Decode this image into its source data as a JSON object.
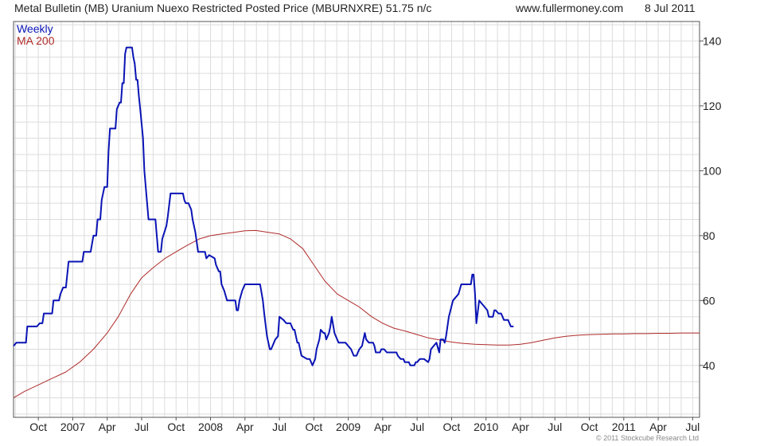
{
  "header": {
    "title": "Metal Bulletin (MB) Uranium Nuexo Restricted Posted Price (MBURNXRE) 51.75 n/c",
    "site": "www.fullermoney.com",
    "date": "8 Jul 2011"
  },
  "footer": {
    "copyright": "© 2011 Stockcube Research Ltd"
  },
  "colors": {
    "weekly": "#0a14b4",
    "ma200": "#b02a2a",
    "grid": "#dcdcdc",
    "axis": "#555555"
  },
  "chart_data": {
    "type": "line",
    "title": "Metal Bulletin (MB) Uranium Nuexo Restricted Posted Price (MBURNXRE) 51.75 n/c",
    "xlabel": "",
    "ylabel": "",
    "ylim": [
      24,
      146
    ],
    "xlim": [
      2006.57,
      2011.55
    ],
    "yticks": [
      40,
      60,
      80,
      100,
      120,
      140
    ],
    "xticks": [
      {
        "label": "Oct",
        "x": 2006.75
      },
      {
        "label": "2007",
        "x": 2007.0
      },
      {
        "label": "Apr",
        "x": 2007.25
      },
      {
        "label": "Jul",
        "x": 2007.5
      },
      {
        "label": "Oct",
        "x": 2007.75
      },
      {
        "label": "2008",
        "x": 2008.0
      },
      {
        "label": "Apr",
        "x": 2008.25
      },
      {
        "label": "Jul",
        "x": 2008.5
      },
      {
        "label": "Oct",
        "x": 2008.75
      },
      {
        "label": "2009",
        "x": 2009.0
      },
      {
        "label": "Apr",
        "x": 2009.25
      },
      {
        "label": "Jul",
        "x": 2009.5
      },
      {
        "label": "Oct",
        "x": 2009.75
      },
      {
        "label": "2010",
        "x": 2010.0
      },
      {
        "label": "Apr",
        "x": 2010.25
      },
      {
        "label": "Jul",
        "x": 2010.5
      },
      {
        "label": "Oct",
        "x": 2010.75
      },
      {
        "label": "2011",
        "x": 2011.0
      },
      {
        "label": "Apr",
        "x": 2011.25
      },
      {
        "label": "Jul",
        "x": 2011.5
      }
    ],
    "grid": true,
    "legend": "top-left",
    "series": [
      {
        "name": "Weekly",
        "points": [
          [
            2006.57,
            46
          ],
          [
            2006.59,
            47
          ],
          [
            2006.66,
            47
          ],
          [
            2006.67,
            52
          ],
          [
            2006.74,
            52
          ],
          [
            2006.76,
            53
          ],
          [
            2006.78,
            53
          ],
          [
            2006.79,
            56
          ],
          [
            2006.85,
            56
          ],
          [
            2006.86,
            60
          ],
          [
            2006.9,
            60
          ],
          [
            2006.91,
            62
          ],
          [
            2006.93,
            64
          ],
          [
            2006.95,
            64
          ],
          [
            2006.96,
            68
          ],
          [
            2006.97,
            72
          ],
          [
            2007.07,
            72
          ],
          [
            2007.08,
            75
          ],
          [
            2007.13,
            75
          ],
          [
            2007.15,
            80
          ],
          [
            2007.17,
            80
          ],
          [
            2007.18,
            85
          ],
          [
            2007.2,
            85
          ],
          [
            2007.21,
            91
          ],
          [
            2007.23,
            95
          ],
          [
            2007.25,
            95
          ],
          [
            2007.26,
            106
          ],
          [
            2007.27,
            113
          ],
          [
            2007.31,
            113
          ],
          [
            2007.32,
            119
          ],
          [
            2007.34,
            121
          ],
          [
            2007.35,
            121
          ],
          [
            2007.36,
            127
          ],
          [
            2007.37,
            127
          ],
          [
            2007.38,
            136
          ],
          [
            2007.39,
            138
          ],
          [
            2007.43,
            138
          ],
          [
            2007.44,
            135
          ],
          [
            2007.45,
            133
          ],
          [
            2007.46,
            128
          ],
          [
            2007.47,
            128
          ],
          [
            2007.48,
            123
          ],
          [
            2007.49,
            119
          ],
          [
            2007.51,
            110
          ],
          [
            2007.52,
            100
          ],
          [
            2007.55,
            85
          ],
          [
            2007.6,
            85
          ],
          [
            2007.62,
            75
          ],
          [
            2007.64,
            75
          ],
          [
            2007.65,
            79
          ],
          [
            2007.68,
            83
          ],
          [
            2007.69,
            86
          ],
          [
            2007.71,
            93
          ],
          [
            2007.8,
            93
          ],
          [
            2007.81,
            91
          ],
          [
            2007.82,
            90
          ],
          [
            2007.84,
            90
          ],
          [
            2007.86,
            88
          ],
          [
            2007.87,
            85
          ],
          [
            2007.89,
            81
          ],
          [
            2007.91,
            75
          ],
          [
            2007.96,
            75
          ],
          [
            2007.97,
            73
          ],
          [
            2007.99,
            74
          ],
          [
            2008.03,
            73
          ],
          [
            2008.04,
            71
          ],
          [
            2008.06,
            69
          ],
          [
            2008.07,
            69
          ],
          [
            2008.08,
            65
          ],
          [
            2008.1,
            63
          ],
          [
            2008.12,
            60
          ],
          [
            2008.18,
            60
          ],
          [
            2008.19,
            57
          ],
          [
            2008.2,
            57
          ],
          [
            2008.21,
            60
          ],
          [
            2008.23,
            63
          ],
          [
            2008.25,
            65
          ],
          [
            2008.36,
            65
          ],
          [
            2008.38,
            60
          ],
          [
            2008.39,
            56
          ],
          [
            2008.41,
            49
          ],
          [
            2008.43,
            45
          ],
          [
            2008.44,
            45
          ],
          [
            2008.47,
            48
          ],
          [
            2008.49,
            49
          ],
          [
            2008.5,
            55
          ],
          [
            2008.53,
            54
          ],
          [
            2008.55,
            53
          ],
          [
            2008.58,
            53
          ],
          [
            2008.6,
            51
          ],
          [
            2008.61,
            51
          ],
          [
            2008.63,
            47
          ],
          [
            2008.64,
            47
          ],
          [
            2008.66,
            43
          ],
          [
            2008.7,
            42
          ],
          [
            2008.72,
            42
          ],
          [
            2008.73,
            41
          ],
          [
            2008.74,
            40
          ],
          [
            2008.76,
            42
          ],
          [
            2008.77,
            45
          ],
          [
            2008.79,
            48
          ],
          [
            2008.8,
            51
          ],
          [
            2008.82,
            50
          ],
          [
            2008.83,
            50
          ],
          [
            2008.84,
            48
          ],
          [
            2008.86,
            50
          ],
          [
            2008.87,
            52
          ],
          [
            2008.88,
            55
          ],
          [
            2008.9,
            50
          ],
          [
            2008.91,
            49
          ],
          [
            2008.93,
            47
          ],
          [
            2008.98,
            47
          ],
          [
            2009.0,
            46
          ],
          [
            2009.02,
            45
          ],
          [
            2009.04,
            43
          ],
          [
            2009.06,
            43
          ],
          [
            2009.07,
            44
          ],
          [
            2009.08,
            45
          ],
          [
            2009.1,
            46
          ],
          [
            2009.12,
            50
          ],
          [
            2009.13,
            48
          ],
          [
            2009.15,
            47
          ],
          [
            2009.18,
            47
          ],
          [
            2009.19,
            46
          ],
          [
            2009.2,
            44
          ],
          [
            2009.23,
            44
          ],
          [
            2009.24,
            45
          ],
          [
            2009.26,
            45
          ],
          [
            2009.28,
            44
          ],
          [
            2009.35,
            44
          ],
          [
            2009.36,
            43
          ],
          [
            2009.38,
            42
          ],
          [
            2009.4,
            42
          ],
          [
            2009.41,
            41
          ],
          [
            2009.44,
            41
          ],
          [
            2009.45,
            40
          ],
          [
            2009.48,
            40
          ],
          [
            2009.49,
            41
          ],
          [
            2009.5,
            41
          ],
          [
            2009.52,
            42
          ],
          [
            2009.55,
            42
          ],
          [
            2009.58,
            41
          ],
          [
            2009.59,
            42
          ],
          [
            2009.6,
            45
          ],
          [
            2009.62,
            46
          ],
          [
            2009.64,
            47
          ],
          [
            2009.66,
            44
          ],
          [
            2009.67,
            48
          ],
          [
            2009.69,
            48
          ],
          [
            2009.7,
            47
          ],
          [
            2009.71,
            49
          ],
          [
            2009.73,
            55
          ],
          [
            2009.76,
            60
          ],
          [
            2009.78,
            61
          ],
          [
            2009.8,
            62
          ],
          [
            2009.82,
            65
          ],
          [
            2009.89,
            65
          ],
          [
            2009.9,
            68
          ],
          [
            2009.91,
            68
          ],
          [
            2009.92,
            62
          ],
          [
            2009.93,
            53
          ],
          [
            2009.95,
            60
          ],
          [
            2009.97,
            59
          ],
          [
            2009.99,
            58
          ],
          [
            2010.01,
            57
          ],
          [
            2010.02,
            55
          ],
          [
            2010.05,
            55
          ],
          [
            2010.06,
            57
          ],
          [
            2010.07,
            57
          ],
          [
            2010.09,
            56
          ],
          [
            2010.11,
            56
          ],
          [
            2010.12,
            55
          ],
          [
            2010.13,
            54
          ],
          [
            2010.16,
            54
          ],
          [
            2010.18,
            52
          ],
          [
            2010.2,
            52
          ]
        ]
      },
      {
        "name": "MA 200",
        "points": [
          [
            2006.57,
            30
          ],
          [
            2006.65,
            32
          ],
          [
            2006.75,
            34
          ],
          [
            2006.85,
            36
          ],
          [
            2006.95,
            38
          ],
          [
            2007.05,
            41
          ],
          [
            2007.15,
            45
          ],
          [
            2007.25,
            50
          ],
          [
            2007.33,
            55
          ],
          [
            2007.42,
            62
          ],
          [
            2007.5,
            67
          ],
          [
            2007.58,
            70
          ],
          [
            2007.67,
            73
          ],
          [
            2007.75,
            75
          ],
          [
            2007.83,
            77
          ],
          [
            2007.92,
            79
          ],
          [
            2008.0,
            80
          ],
          [
            2008.08,
            80.5
          ],
          [
            2008.17,
            81
          ],
          [
            2008.25,
            81.5
          ],
          [
            2008.33,
            81.6
          ],
          [
            2008.42,
            81
          ],
          [
            2008.5,
            80.5
          ],
          [
            2008.58,
            79
          ],
          [
            2008.67,
            76
          ],
          [
            2008.75,
            71
          ],
          [
            2008.83,
            66
          ],
          [
            2008.92,
            62
          ],
          [
            2009.0,
            60
          ],
          [
            2009.08,
            58
          ],
          [
            2009.17,
            55
          ],
          [
            2009.25,
            53
          ],
          [
            2009.33,
            51.5
          ],
          [
            2009.42,
            50.5
          ],
          [
            2009.5,
            49.5
          ],
          [
            2009.58,
            48.5
          ],
          [
            2009.67,
            47.8
          ],
          [
            2009.75,
            47.2
          ],
          [
            2009.83,
            46.8
          ],
          [
            2009.92,
            46.5
          ],
          [
            2010.0,
            46.4
          ],
          [
            2010.08,
            46.3
          ],
          [
            2010.17,
            46.3
          ],
          [
            2010.25,
            46.5
          ],
          [
            2010.33,
            47
          ],
          [
            2010.42,
            47.8
          ],
          [
            2010.5,
            48.5
          ],
          [
            2010.58,
            49
          ],
          [
            2010.67,
            49.3
          ],
          [
            2010.75,
            49.5
          ],
          [
            2010.83,
            49.6
          ],
          [
            2010.92,
            49.7
          ],
          [
            2011.0,
            49.7
          ],
          [
            2011.08,
            49.8
          ],
          [
            2011.17,
            49.8
          ],
          [
            2011.25,
            49.9
          ],
          [
            2011.33,
            49.9
          ],
          [
            2011.42,
            50
          ],
          [
            2011.5,
            50
          ],
          [
            2011.55,
            50
          ]
        ]
      }
    ]
  }
}
